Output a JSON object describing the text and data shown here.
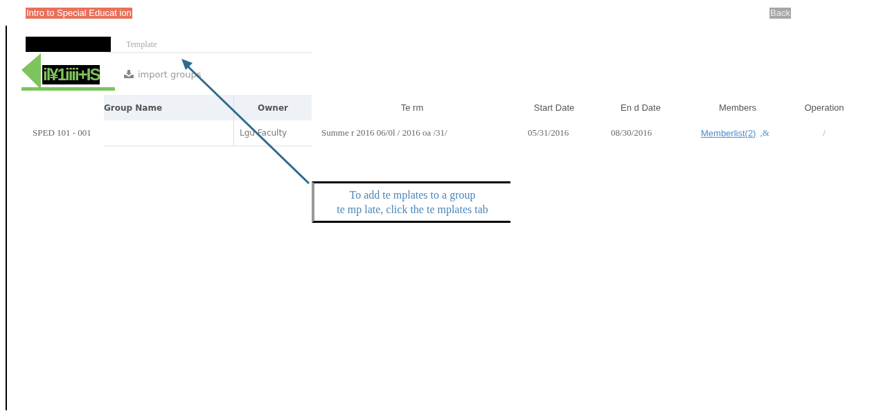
{
  "header": {
    "title": "Intro to Special Educat ion",
    "back": "Back"
  },
  "tabs": [
    {
      "label": "Template",
      "selected": false
    }
  ],
  "logo_text": "il¥1iiii+IS",
  "toolbar": {
    "import_button": "import groups"
  },
  "table": {
    "columns": [
      "Group Name",
      "Owner",
      "Te rm",
      "Start Date",
      "En d Date",
      "Members",
      "Operation"
    ],
    "rows": [
      {
        "course": "SPED 101 - 001",
        "group_name": "",
        "owner": "Lgu Faculty",
        "term": "Summe r 2016 06/0l / 2016 oa /31/",
        "start": "05/31/2016",
        "end": "08/30/2016",
        "members_link": "Memberlist(2)",
        "members_extra": ",&",
        "operation": "/"
      }
    ]
  },
  "callout": {
    "lines": [
      "To add te mplates to a group",
      "te mp late, click the te mplates tab"
    ]
  }
}
